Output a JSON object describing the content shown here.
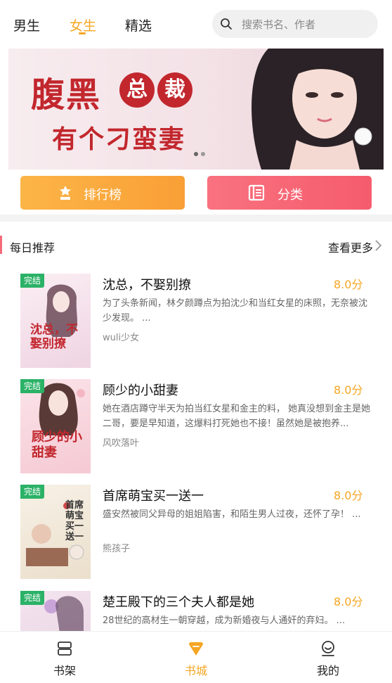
{
  "nav": {
    "tabs": [
      {
        "label": "男生"
      },
      {
        "label": "女生",
        "active": true
      },
      {
        "label": "精选"
      }
    ],
    "search_placeholder": "搜索书名、作者"
  },
  "banner": {
    "line1": "腹黑",
    "circle1": "总",
    "circle2": "裁",
    "line2": "有个刁蛮妻",
    "dots": 2,
    "active_dot": 1
  },
  "actions": {
    "rank_label": "排行榜",
    "category_label": "分类"
  },
  "section": {
    "title": "每日推荐",
    "more": "查看更多"
  },
  "books": [
    {
      "badge": "完结",
      "title": "沈总，不娶别撩",
      "score": "8.0分",
      "desc": "为了头条新闻，林夕颜蹲点为拍沈少和当红女星的床照，无奈被沈少发现。 ...",
      "author": "wuli少女",
      "cover_text": "沈总，不娶别撩",
      "cover_bg": "#f4dfe8"
    },
    {
      "badge": "完结",
      "title": "顾少的小甜妻",
      "score": "8.0分",
      "desc": "她在酒店蹲守半天为拍当红女星和金主的料， 她真没想到金主是她二哥，要是早知道，这爆料打死她也不接！虽然她是被抱养...",
      "author": "风吹落叶",
      "cover_text": "顾少的小甜妻",
      "cover_bg": "#f7d7de"
    },
    {
      "badge": "完结",
      "title": "首席萌宝买一送一",
      "score": "8.0分",
      "desc": "盛安然被同父异母的姐姐陷害，和陌生男人过夜，还怀了孕！ ...",
      "author": "熊孩子",
      "cover_text": "首席萌宝买一送一",
      "cover_bg": "#f3ece0"
    },
    {
      "badge": "完结",
      "title": "楚王殿下的三个夫人都是她",
      "score": "8.0分",
      "desc": "28世纪的高材生一朝穿越，成为新婚夜与人通奸的弃妇。 ...",
      "author": "",
      "cover_text": "",
      "cover_bg": "#efe0ea"
    }
  ],
  "bottom_tabs": [
    {
      "label": "书架",
      "icon": "bookshelf-icon"
    },
    {
      "label": "书城",
      "icon": "bookstore-icon",
      "active": true
    },
    {
      "label": "我的",
      "icon": "profile-icon"
    }
  ],
  "colors": {
    "accent": "#f5a623",
    "badge": "#2bb267",
    "rank_button": "#f99f36",
    "category_button": "#f55c6d",
    "section_bar": "#f66b7a"
  }
}
